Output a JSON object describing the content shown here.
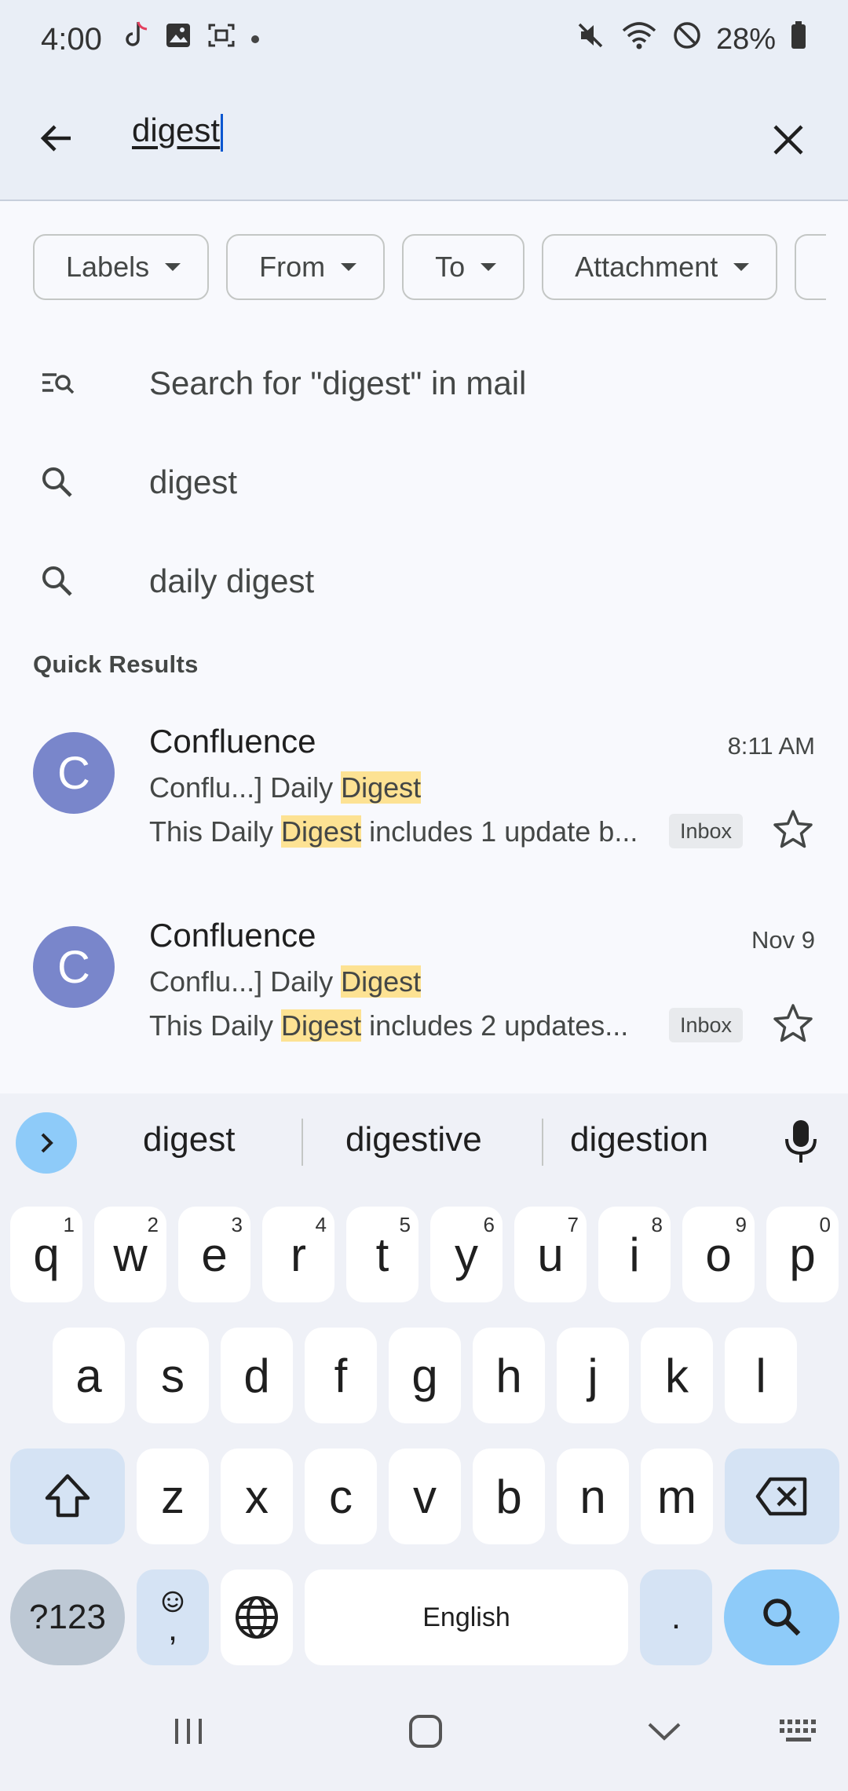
{
  "status_bar": {
    "time": "4:00",
    "battery": "28%",
    "icons": [
      "tiktok-icon",
      "image-icon",
      "screenshot-icon",
      "mute-icon",
      "wifi-icon",
      "dnd-icon",
      "battery-icon"
    ]
  },
  "search": {
    "query": "digest"
  },
  "filters": [
    {
      "label": "Labels"
    },
    {
      "label": "From"
    },
    {
      "label": "To"
    },
    {
      "label": "Attachment"
    }
  ],
  "suggestions": [
    {
      "text": "Search for \"digest\" in mail",
      "icon": "search-list-icon"
    },
    {
      "text": "digest",
      "icon": "search-icon"
    },
    {
      "text": "daily digest",
      "icon": "search-icon"
    }
  ],
  "quick_results_label": "Quick Results",
  "results": [
    {
      "avatar_letter": "C",
      "sender": "Confluence",
      "time": "8:11 AM",
      "subject_prefix": "Conflu...] Daily ",
      "subject_highlight": "Digest",
      "snippet_prefix": "This Daily ",
      "snippet_highlight": "Digest",
      "snippet_suffix": " includes 1 update b...",
      "label": "Inbox"
    },
    {
      "avatar_letter": "C",
      "sender": "Confluence",
      "time": "Nov 9",
      "subject_prefix": "Conflu...] Daily ",
      "subject_highlight": "Digest",
      "snippet_prefix": "This Daily ",
      "snippet_highlight": "Digest",
      "snippet_suffix": " includes 2 updates...",
      "label": "Inbox"
    }
  ],
  "keyboard": {
    "suggestions": [
      "digest",
      "digestive",
      "digestion"
    ],
    "row1": [
      {
        "k": "q",
        "n": "1"
      },
      {
        "k": "w",
        "n": "2"
      },
      {
        "k": "e",
        "n": "3"
      },
      {
        "k": "r",
        "n": "4"
      },
      {
        "k": "t",
        "n": "5"
      },
      {
        "k": "y",
        "n": "6"
      },
      {
        "k": "u",
        "n": "7"
      },
      {
        "k": "i",
        "n": "8"
      },
      {
        "k": "o",
        "n": "9"
      },
      {
        "k": "p",
        "n": "0"
      }
    ],
    "row2": [
      "a",
      "s",
      "d",
      "f",
      "g",
      "h",
      "j",
      "k",
      "l"
    ],
    "row3": [
      "z",
      "x",
      "c",
      "v",
      "b",
      "n",
      "m"
    ],
    "sym_label": "?123",
    "comma_label": ",",
    "space_label": "English",
    "period_label": "."
  },
  "colors": {
    "header_bg": "#e9eef6",
    "avatar": "#7986cb",
    "highlight": "#fde293",
    "accent_key": "#8ecbf9"
  }
}
